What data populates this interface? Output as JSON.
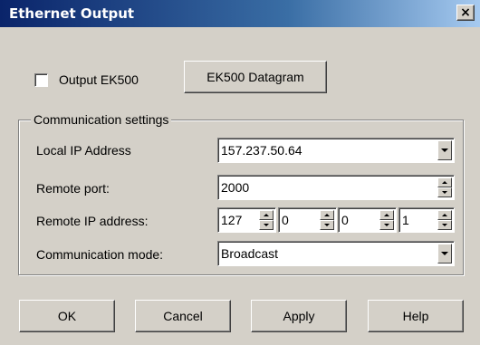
{
  "window": {
    "title": "Ethernet Output",
    "close_glyph": "×"
  },
  "output": {
    "checkbox_label": "Output EK500",
    "checked": false,
    "datagram_button": "EK500 Datagram"
  },
  "group": {
    "title": "Communication settings",
    "local_ip": {
      "label": "Local IP Address",
      "value": "157.237.50.64"
    },
    "remote_port": {
      "label": "Remote port:",
      "value": "2000"
    },
    "remote_ip": {
      "label": "Remote IP address:",
      "octets": [
        "127",
        "0",
        "0",
        "1"
      ]
    },
    "comm_mode": {
      "label": "Communication mode:",
      "value": "Broadcast"
    }
  },
  "buttons": {
    "ok": "OK",
    "cancel": "Cancel",
    "apply": "Apply",
    "help": "Help"
  },
  "icons": {
    "close": "close-icon",
    "dropdown": "chevron-down-icon",
    "spin_up": "spin-up-icon",
    "spin_down": "spin-down-icon"
  }
}
